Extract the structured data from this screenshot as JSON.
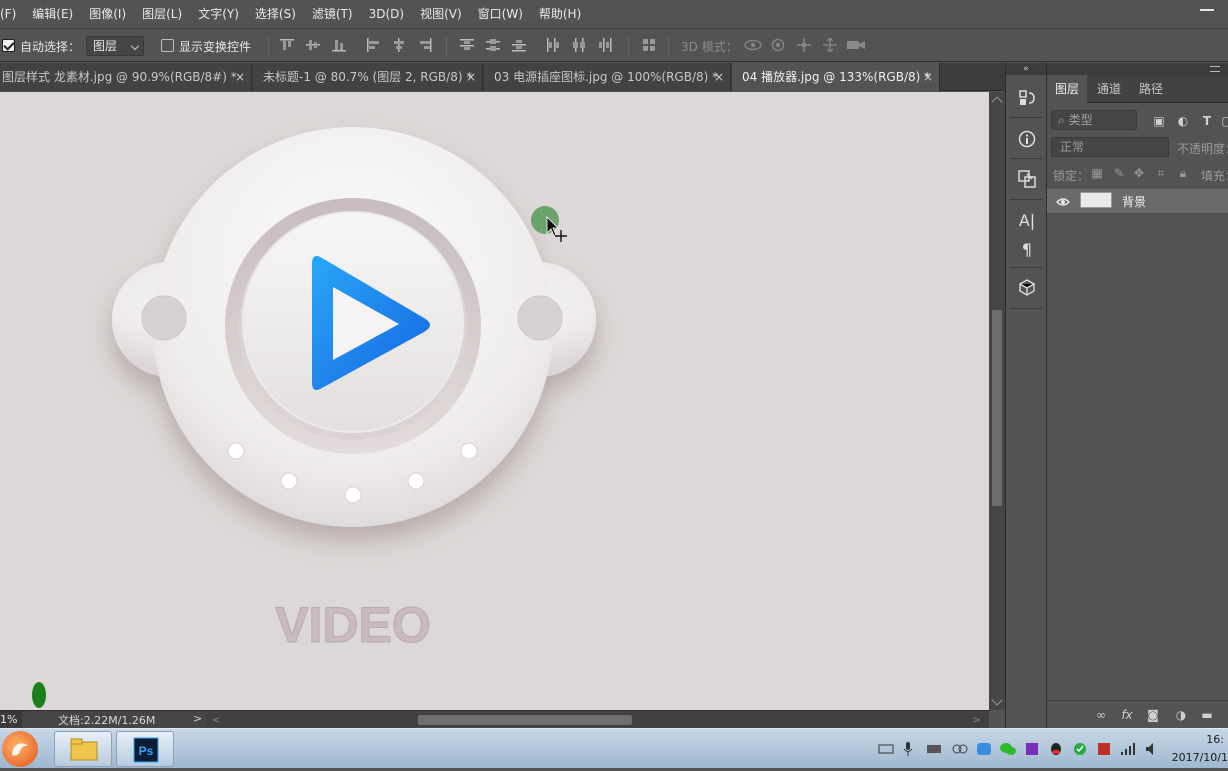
{
  "menubar": {
    "items": [
      "(F)",
      "编辑(E)",
      "图像(I)",
      "图层(L)",
      "文字(Y)",
      "选择(S)",
      "滤镜(T)",
      "3D(D)",
      "视图(V)",
      "窗口(W)",
      "帮助(H)"
    ]
  },
  "options": {
    "auto_select_label": "自动选择：",
    "auto_select_value": "图层",
    "show_transform_label": "显示变换控件",
    "mode_3d_label": "3D 模式："
  },
  "tabs": [
    {
      "label": "图层样式   龙素材.jpg @ 90.9%(RGB/8#) *",
      "active": false
    },
    {
      "label": "未标题-1 @ 80.7% (图层 2, RGB/8) *",
      "active": false
    },
    {
      "label": "03 电源插座图标.jpg @ 100%(RGB/8) *",
      "active": false
    },
    {
      "label": "04 播放器.jpg @ 133%(RGB/8) *",
      "active": true
    }
  ],
  "tab_close_glyph": "×",
  "canvas": {
    "artwork_text": "VIDEO",
    "bg_color": "#dcd8d7",
    "play_color": "#1e88f0"
  },
  "status": {
    "zoom": "1%",
    "docsize": "文档:2.22M/1.26M",
    "arrow": ">"
  },
  "panel": {
    "tabs": [
      "图层",
      "通道",
      "路径"
    ],
    "filter_placeholder": "类型",
    "blend_mode": "正常",
    "opacity_label": "不透明度：",
    "lock_label": "锁定：",
    "fill_label": "填充：",
    "layer_name": "背景"
  },
  "clock": {
    "time": "16:",
    "date": "2017/10/1"
  }
}
